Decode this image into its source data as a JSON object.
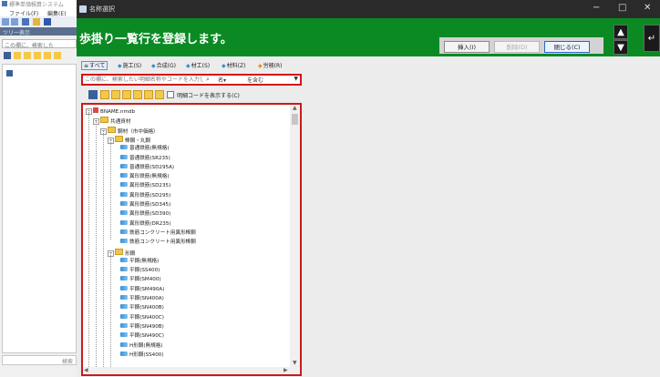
{
  "background_window": {
    "title": "標準単価積算システム",
    "menu": [
      "ファイル(F)",
      "編集(E)"
    ],
    "tree_header": "ツリー表示",
    "search_placeholder": "この欄に、検索した",
    "bottom_label": "検索"
  },
  "dialog": {
    "title": "名称選択",
    "header": "歩掛り一覧行を登録します。",
    "buttons": {
      "insert": "挿入(I)",
      "delete": "削除(D)",
      "close": "閉じる(C)"
    },
    "window_controls": [
      "−",
      "□",
      "✕"
    ]
  },
  "filter_tabs": [
    {
      "label": "すべて",
      "selected": true
    },
    {
      "label": "施工(S)",
      "selected": false
    },
    {
      "label": "合成(G)",
      "selected": false
    },
    {
      "label": "材工(S)",
      "selected": false
    },
    {
      "label": "材料(Z)",
      "selected": false
    },
    {
      "label": "労務(R)",
      "selected": false
    }
  ],
  "search": {
    "placeholder": "この欄に、検索したい明細名称やコードを入力します",
    "mode": "名▾",
    "condition": "を含む"
  },
  "options": {
    "show_detail_code": "明細コードを表示する(C)",
    "show_detail_code_checked": false
  },
  "tree": [
    {
      "label": "BNAME.nmdb",
      "level": 0,
      "kind": "db",
      "toggle": "−"
    },
    {
      "label": "共通資材",
      "level": 1,
      "kind": "folder",
      "toggle": "−"
    },
    {
      "label": "鋼材（市中価格）",
      "level": 2,
      "kind": "folder",
      "toggle": "−"
    },
    {
      "label": "棒鋼・丸鋼",
      "level": 3,
      "kind": "folder",
      "toggle": "−"
    },
    {
      "label": "普通鉄筋(無規格)",
      "level": 4,
      "kind": "item"
    },
    {
      "label": "普通鉄筋(SR235)",
      "level": 4,
      "kind": "item"
    },
    {
      "label": "普通鉄筋(SD295A)",
      "level": 4,
      "kind": "item"
    },
    {
      "label": "異形鉄筋(無規格)",
      "level": 4,
      "kind": "item"
    },
    {
      "label": "異形鉄筋(SD235)",
      "level": 4,
      "kind": "item"
    },
    {
      "label": "異形鉄筋(SD295)",
      "level": 4,
      "kind": "item"
    },
    {
      "label": "異形鉄筋(SD345)",
      "level": 4,
      "kind": "item"
    },
    {
      "label": "異形鉄筋(SD390)",
      "level": 4,
      "kind": "item"
    },
    {
      "label": "異形鉄筋(DR235)",
      "level": 4,
      "kind": "item"
    },
    {
      "label": "鉄筋コンクリート用異形棒鋼",
      "level": 4,
      "kind": "item"
    },
    {
      "label": "鉄筋コンクリート用異形棒鋼",
      "level": 4,
      "kind": "item"
    },
    {
      "label": "形鋼",
      "level": 3,
      "kind": "folder",
      "toggle": "−"
    },
    {
      "label": "平鋼(無規格)",
      "level": 4,
      "kind": "item"
    },
    {
      "label": "平鋼(SS400)",
      "level": 4,
      "kind": "item"
    },
    {
      "label": "平鋼(SM400)",
      "level": 4,
      "kind": "item"
    },
    {
      "label": "平鋼(SM490A)",
      "level": 4,
      "kind": "item"
    },
    {
      "label": "平鋼(SN400A)",
      "level": 4,
      "kind": "item"
    },
    {
      "label": "平鋼(SN400B)",
      "level": 4,
      "kind": "item"
    },
    {
      "label": "平鋼(SN400C)",
      "level": 4,
      "kind": "item"
    },
    {
      "label": "平鋼(SN490B)",
      "level": 4,
      "kind": "item"
    },
    {
      "label": "平鋼(SN490C)",
      "level": 4,
      "kind": "item"
    },
    {
      "label": "H形鋼(無規格)",
      "level": 4,
      "kind": "item"
    },
    {
      "label": "H形鋼(SS400)",
      "level": 4,
      "kind": "item"
    }
  ],
  "colors": {
    "header_green": "#0b8a24",
    "highlight_red": "#d01818",
    "titlebar": "#2a2a2a"
  }
}
